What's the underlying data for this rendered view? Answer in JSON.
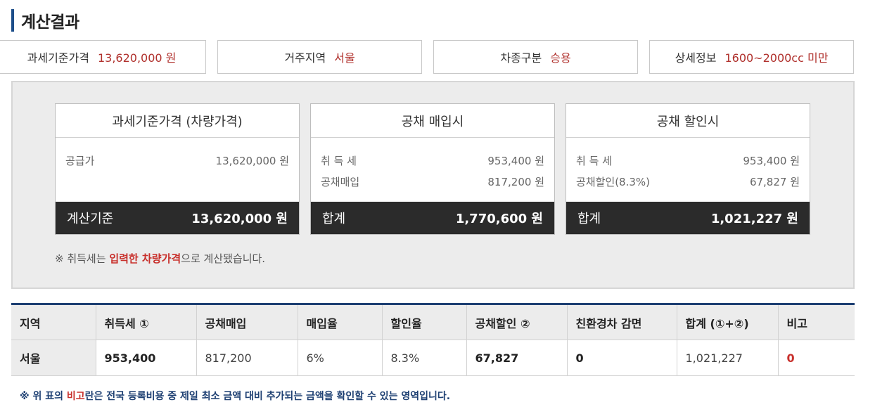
{
  "title": "계산결과",
  "summary": [
    {
      "label": "과세기준가격",
      "value": "13,620,000 원"
    },
    {
      "label": "거주지역",
      "value": "서울"
    },
    {
      "label": "차종구분",
      "value": "승용"
    },
    {
      "label": "상세정보",
      "value": "1600~2000cc 미만"
    }
  ],
  "cards": [
    {
      "header": "과세기준가격 (차량가격)",
      "rows": [
        {
          "label": "공급가",
          "value": "13,620,000 원"
        }
      ],
      "footer": {
        "label": "계산기준",
        "value": "13,620,000 원"
      }
    },
    {
      "header": "공채 매입시",
      "rows": [
        {
          "label": "취 득 세",
          "value": "953,400 원"
        },
        {
          "label": "공채매입",
          "value": "817,200 원"
        }
      ],
      "footer": {
        "label": "합계",
        "value": "1,770,600 원"
      }
    },
    {
      "header": "공채 할인시",
      "rows": [
        {
          "label": "취 득 세",
          "value": "953,400 원"
        },
        {
          "label": "공채할인(8.3%)",
          "value": "67,827 원"
        }
      ],
      "footer": {
        "label": "합계",
        "value": "1,021,227 원"
      }
    }
  ],
  "calc_note": {
    "prefix": "※ 취득세는 ",
    "highlight": "입력한 차량가격",
    "suffix": "으로 계산됐습니다."
  },
  "table": {
    "headers": [
      "지역",
      "취득세 ①",
      "공채매입",
      "매입율",
      "할인율",
      "공채할인 ②",
      "친환경차 감면",
      "합계 (①+②)",
      "비고"
    ],
    "rows": [
      [
        "서울",
        "953,400",
        "817,200",
        "6%",
        "8.3%",
        "67,827",
        "0",
        "1,021,227",
        "0"
      ]
    ]
  },
  "bottom_note": {
    "prefix": "※ 위 표의 ",
    "highlight": "비고",
    "suffix": "란은 전국 등록비용 중 제일 최소 금액 대비 추가되는 금액을 확인할 수 있는 영역입니다."
  },
  "colors": {
    "accent_navy": "#1d3f72",
    "highlight_red": "#c8302c",
    "footer_dark": "#2b2b2b"
  }
}
